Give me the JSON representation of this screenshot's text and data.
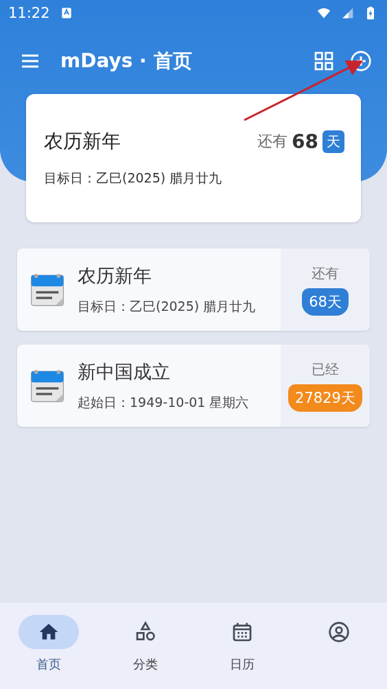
{
  "status_bar": {
    "time": "11:22"
  },
  "app_bar": {
    "title": "mDays · 首页"
  },
  "featured": {
    "title": "农历新年",
    "prefix": "还有",
    "count": "68",
    "unit": "天",
    "date": "目标日：乙巳(2025) 腊月廿九"
  },
  "events": [
    {
      "title": "农历新年",
      "date": "目标日：乙巳(2025) 腊月廿九",
      "label": "还有",
      "count": "68天",
      "color": "#2f7fd6"
    },
    {
      "title": "新中国成立",
      "date": "起始日：1949-10-01 星期六",
      "label": "已经",
      "count": "27829天",
      "color": "#f28a1c"
    }
  ],
  "bottom_nav": [
    {
      "kind": "home",
      "label": "首页",
      "selected": true
    },
    {
      "kind": "category",
      "label": "分类",
      "selected": false
    },
    {
      "kind": "calendar",
      "label": "日历",
      "selected": false
    },
    {
      "kind": "profile",
      "selected": false
    }
  ]
}
